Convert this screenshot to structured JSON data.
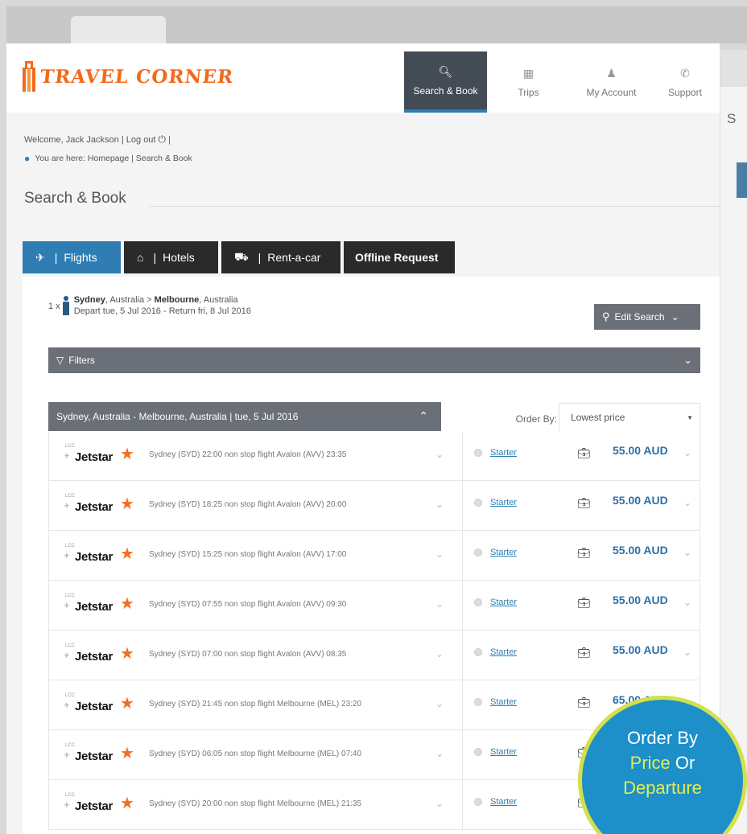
{
  "brand": {
    "logo_text": "TRAVEL CORNER"
  },
  "nav": [
    {
      "label": "Search & Book",
      "icon": "search-icon",
      "active": true
    },
    {
      "label": "Trips",
      "icon": "suitcase-icon",
      "active": false
    },
    {
      "label": "My Account",
      "icon": "user-icon",
      "active": false
    },
    {
      "label": "Support",
      "icon": "phone-icon",
      "active": false
    }
  ],
  "user": {
    "welcome": "Welcome, Jack Jackson",
    "logout": "Log out"
  },
  "breadcrumb": "You are here: Homepage | Search & Book",
  "page_title": "Search & Book",
  "side_panel": {
    "letter": "S"
  },
  "tabs": [
    {
      "label": "Flights",
      "icon": "plane-icon"
    },
    {
      "label": "Hotels",
      "icon": "home-icon"
    },
    {
      "label": "Rent-a-car",
      "icon": "car-icon"
    },
    {
      "label": "Offline Request"
    }
  ],
  "search": {
    "passengers": "1 x",
    "from_city": "Sydney",
    "from_country": ", Australia > ",
    "to_city": "Melbourne",
    "to_country": ", Australia",
    "dates": "Depart tue, 5 Jul 2016   -  Return fri, 8 Jul 2016",
    "edit_label": "Edit Search"
  },
  "filters_label": "Filters",
  "leg_title": "Sydney, Australia - Melbourne, Australia | tue, 5 Jul 2016",
  "order": {
    "label": "Order By:",
    "selected": "Lowest price"
  },
  "flights": [
    {
      "airline": "Jetstar",
      "lcc": "LCC",
      "info": "Sydney (SYD) 22:00  non stop flight  Avalon (AVV) 23:35",
      "fare": "Starter",
      "price": "55.00 AUD"
    },
    {
      "airline": "Jetstar",
      "lcc": "LCC",
      "info": "Sydney (SYD) 18:25  non stop flight  Avalon (AVV) 20:00",
      "fare": "Starter",
      "price": "55.00 AUD"
    },
    {
      "airline": "Jetstar",
      "lcc": "LCC",
      "info": "Sydney (SYD) 15:25  non stop flight  Avalon (AVV) 17:00",
      "fare": "Starter",
      "price": "55.00 AUD"
    },
    {
      "airline": "Jetstar",
      "lcc": "LCC",
      "info": "Sydney (SYD) 07:55  non stop flight  Avalon (AVV) 09:30",
      "fare": "Starter",
      "price": "55.00 AUD"
    },
    {
      "airline": "Jetstar",
      "lcc": "LCC",
      "info": "Sydney (SYD) 07:00  non stop flight  Avalon (AVV) 08:35",
      "fare": "Starter",
      "price": "55.00 AUD"
    },
    {
      "airline": "Jetstar",
      "lcc": "LCC",
      "info": "Sydney (SYD) 21:45  non stop flight  Melbourne (MEL) 23:20",
      "fare": "Starter",
      "price": "65.00 AUD"
    },
    {
      "airline": "Jetstar",
      "lcc": "LCC",
      "info": "Sydney (SYD) 06:05  non stop flight  Melbourne (MEL) 07:40",
      "fare": "Starter",
      "price": ""
    },
    {
      "airline": "Jetstar",
      "lcc": "LCC",
      "info": "Sydney (SYD) 20:00  non stop flight  Melbourne (MEL) 21:35",
      "fare": "Starter",
      "price": ""
    }
  ],
  "badge": {
    "line1": "Order By",
    "word_price": "Price",
    "word_or": " Or",
    "word_departure": "Departure"
  },
  "colors": {
    "accent": "#2f7db3",
    "brand_orange": "#f26a1b",
    "badge_blue": "#1d8fc9",
    "badge_ring": "#d4e04a",
    "price_blue": "#2f6fa3"
  }
}
